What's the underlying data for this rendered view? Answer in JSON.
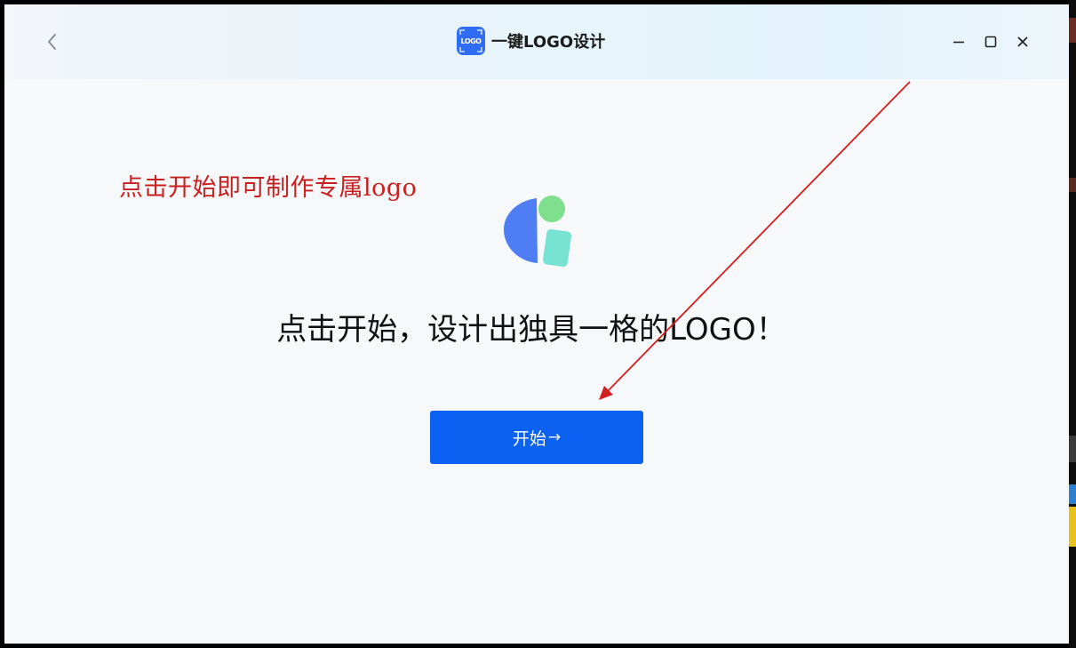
{
  "window": {
    "title": "一键LOGO设计",
    "app_icon_text": "LOGO"
  },
  "titlebar": {
    "back_icon": "chevron-left-icon",
    "minimize_icon": "minimize-icon",
    "maximize_icon": "maximize-icon",
    "close_icon": "close-icon"
  },
  "main": {
    "annotation": "点击开始即可制作专属logo",
    "headline": "点击开始，设计出独具一格的LOGO！",
    "start_button": {
      "label": "开始",
      "arrow": "→"
    }
  },
  "colors": {
    "primary_button": "#0b61f2",
    "annotation_red": "#c82020",
    "logo_blue": "#4f7df3",
    "logo_green": "#7edf8e",
    "logo_teal": "#77e3d3"
  }
}
